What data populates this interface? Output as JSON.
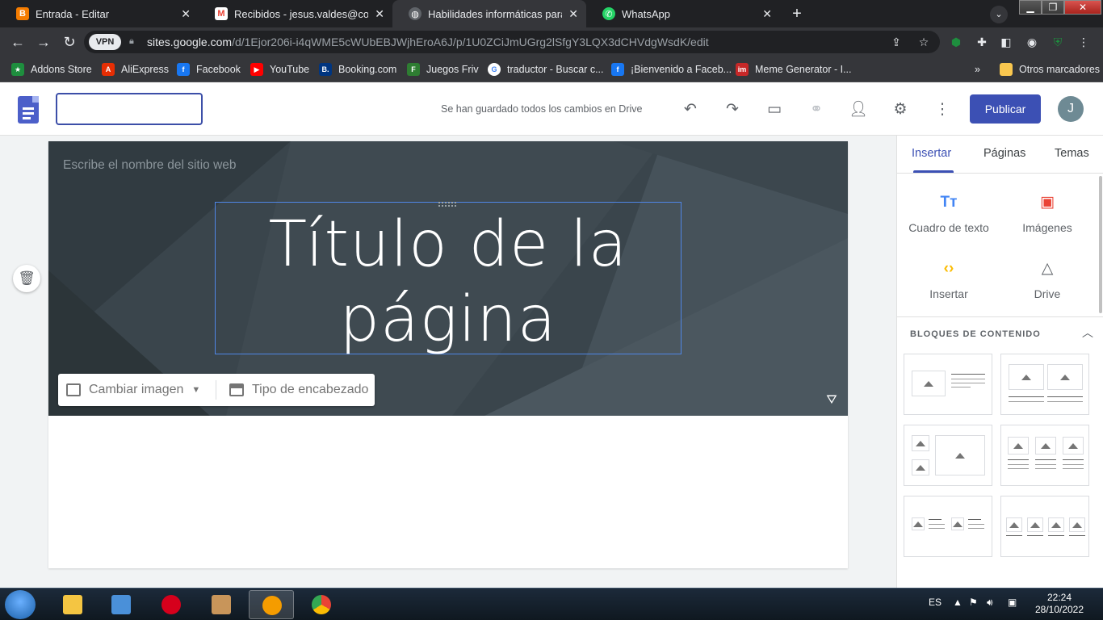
{
  "browser": {
    "tabs": [
      {
        "title": "Entrada - Editar",
        "icon": "blogger-icon",
        "color": "#f57c00"
      },
      {
        "title": "Recibidos - jesus.valdes@correou",
        "icon": "gmail-icon",
        "color": "#ea4335"
      },
      {
        "title": "Habilidades informáticas para la",
        "icon": "globe-icon",
        "color": "#9aa0a6"
      },
      {
        "title": "WhatsApp",
        "icon": "whatsapp-icon",
        "color": "#25d366"
      }
    ],
    "url_domain": "sites.google.com",
    "url_path": "/d/1Ejor206i-i4qWME5cWUbEBJWjhEroA6J/p/1U0ZCiJmUGrg2lSfgY3LQX3dCHVdgWsdK/edit",
    "vpn_label": "VPN",
    "bookmarks": [
      {
        "label": "Addons Store",
        "color": "#1e8e3e",
        "glyph": "★"
      },
      {
        "label": "AliExpress",
        "color": "#e62e04",
        "glyph": "A"
      },
      {
        "label": "Facebook",
        "color": "#1877f2",
        "glyph": "f"
      },
      {
        "label": "YouTube",
        "color": "#ff0000",
        "glyph": "▶"
      },
      {
        "label": "Booking.com",
        "color": "#003580",
        "glyph": "B."
      },
      {
        "label": "Juegos Friv",
        "color": "#2e7d32",
        "glyph": "F"
      },
      {
        "label": "traductor - Buscar c...",
        "color": "#4285f4",
        "glyph": "G"
      },
      {
        "label": "¡Bienvenido a Faceb...",
        "color": "#1877f2",
        "glyph": "f"
      },
      {
        "label": "Meme Generator - I...",
        "color": "#c62828",
        "glyph": "im"
      }
    ],
    "bookmarks_more": "»",
    "other_bookmarks": "Otros marcadores"
  },
  "sites": {
    "site_name_value": "",
    "save_status": "Se han guardado todos los cambios en Drive",
    "publish_label": "Publicar",
    "avatar_initial": "J",
    "site_name_placeholder": "Escribe el nombre del sitio web",
    "page_title": "Título de la página",
    "change_image_label": "Cambiar imagen",
    "header_type_label": "Tipo de encabezado"
  },
  "panel": {
    "tabs": [
      "Insertar",
      "Páginas",
      "Temas"
    ],
    "active_tab": "Insertar",
    "insert_items": [
      {
        "label": "Cuadro de texto",
        "icon": "text-box-icon",
        "color": "#4285f4"
      },
      {
        "label": "Imágenes",
        "icon": "image-icon",
        "color": "#ea4335"
      },
      {
        "label": "Insertar",
        "icon": "embed-icon",
        "color": "#fbbc04"
      },
      {
        "label": "Drive",
        "icon": "drive-icon",
        "color": "#5f6368"
      }
    ],
    "blocks_heading": "BLOQUES DE CONTENIDO"
  },
  "taskbar": {
    "lang": "ES",
    "time": "22:24",
    "date": "28/10/2022"
  }
}
